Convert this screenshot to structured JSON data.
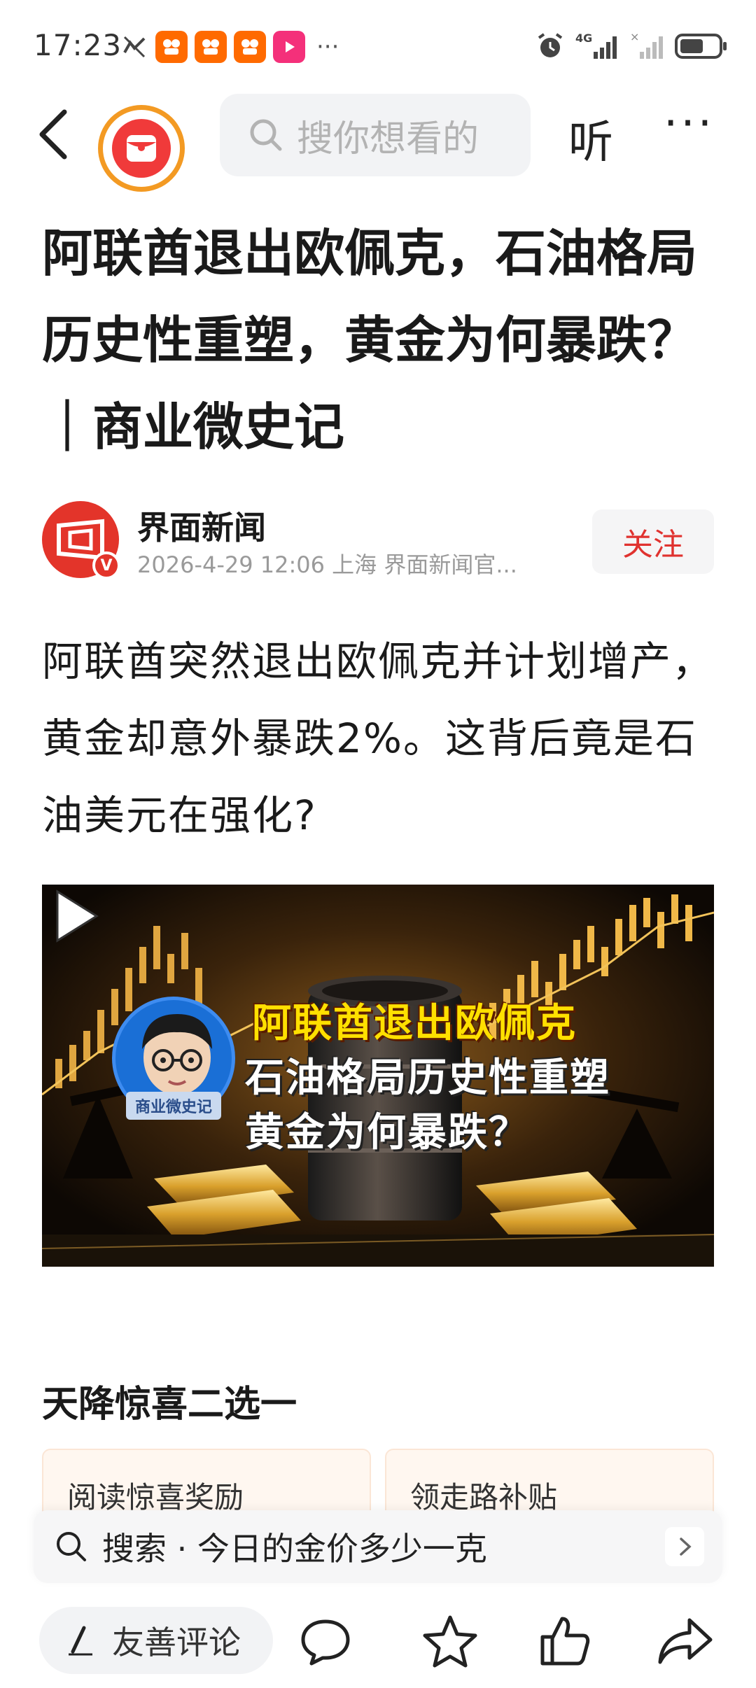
{
  "status_bar": {
    "time": "17:23",
    "dots": "···",
    "network": "4G",
    "battery_level": 0.62
  },
  "top_nav": {
    "search_placeholder": "搜你想看的",
    "listen_label": "听",
    "more_label": "···"
  },
  "article": {
    "title": "阿联酋退出欧佩克，石油格局历史性重塑，黄金为何暴跌？ ｜商业微史记",
    "author": {
      "name": "界面新闻",
      "verified_mark": "V",
      "meta": "2026-4-29  12:06  上海  界面新闻官..."
    },
    "follow_label": "关注",
    "summary": "阿联酋突然退出欧佩克并计划增产，黄金却意外暴跌2%。这背后竟是石油美元在强化?",
    "video": {
      "line1": "阿联酋退出欧佩克",
      "line2": "石油格局历史性重塑",
      "line3": "黄金为何暴跌？",
      "host_tag": "商业微史记"
    }
  },
  "surprise": {
    "title": "天降惊喜二选一",
    "cards": [
      {
        "label": "阅读惊喜奖励"
      },
      {
        "label": "领走路补贴"
      }
    ]
  },
  "suggest": {
    "text": "搜索 · 今日的金价多少一克"
  },
  "bottom_bar": {
    "comment_label": "友善评论"
  },
  "colors": {
    "accent_red": "#e0322f",
    "logo_ring": "#f39a23",
    "gold_text": "#ffe000"
  }
}
